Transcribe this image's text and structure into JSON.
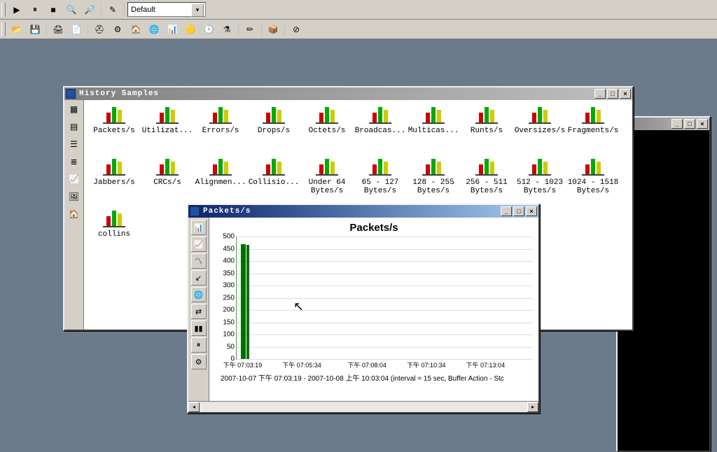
{
  "toolbar1": {
    "combo_value": "Default"
  },
  "history": {
    "title": "History Samples",
    "items": [
      "Packets/s",
      "Utilizat...",
      "Errors/s",
      "Drops/s",
      "Octets/s",
      "Broadcas...",
      "Multicas...",
      "Runts/s",
      "Oversizes/s",
      "Fragments/s",
      "Jabbers/s",
      "CRCs/s",
      "Alignmen...",
      "Collisio...",
      "Under 64\nBytes/s",
      "65 - 127\nBytes/s",
      "128 - 255\nBytes/s",
      "256 - 511\nBytes/s",
      "512 - 1023\nBytes/s",
      "1024 - 1518\nBytes/s",
      "collins"
    ]
  },
  "chart": {
    "title": "Packets/s",
    "window_title": "Packets/s",
    "footer": "2007-10-07 下午 07:03:19 - 2007-10-08 上午 10:03:04  (interval = 15 sec,  Buffer Action - Stc"
  },
  "chart_data": {
    "type": "bar",
    "title": "Packets/s",
    "ylabel": "",
    "xlabel": "",
    "ylim": [
      0,
      500
    ],
    "y_ticks": [
      0,
      50,
      100,
      150,
      200,
      250,
      300,
      350,
      400,
      450,
      500
    ],
    "x_labels": [
      "下午 07:03:19",
      "下午 07:05:34",
      "下午 07:08:04",
      "下午 07:10:34",
      "下午 07:13:04"
    ],
    "x_positions_pct": [
      2,
      22,
      44,
      64,
      84
    ],
    "series": [
      {
        "name": "Packets/s",
        "color": "#007000",
        "bars": [
          {
            "x_pct": 1.5,
            "width_pct": 1.5,
            "value": 470
          },
          {
            "x_pct": 3.2,
            "width_pct": 1.0,
            "value": 465
          }
        ]
      }
    ]
  }
}
